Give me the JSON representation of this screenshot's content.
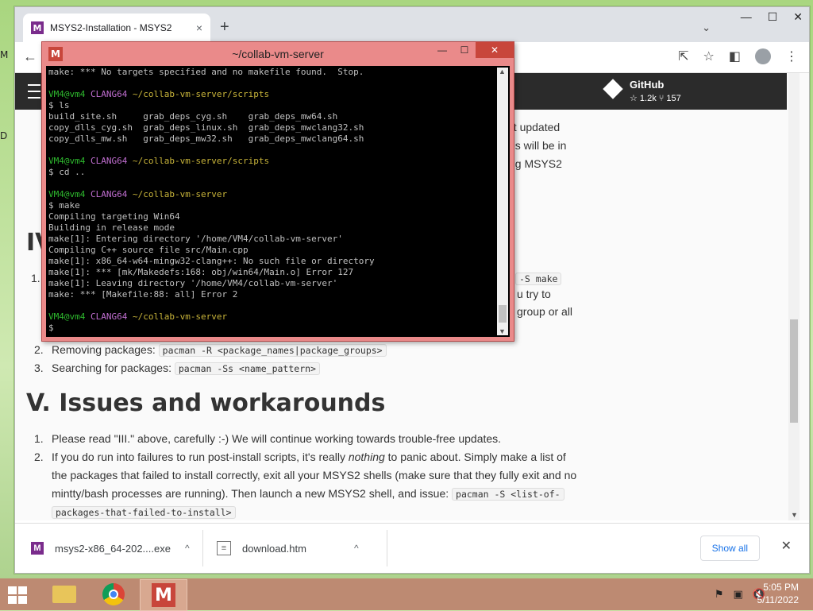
{
  "desktop": {
    "edge_left_1": "M",
    "edge_left_2": "D"
  },
  "browser": {
    "tab_title": "MSYS2-Installation - MSYS2",
    "tab_favicon": "M",
    "new_tab": "+",
    "tab_close": "×",
    "win_min": "—",
    "win_max": "☐",
    "win_close": "✕",
    "tab_dropdown": "⌄",
    "back": "←",
    "toolbar_icons": {
      "share": "⇱",
      "star": "☆",
      "sidebar": "◧",
      "menu": "⋮"
    }
  },
  "site": {
    "github_name": "GitHub",
    "github_stats": "☆ 1.2k  ⑂ 157",
    "frag_not_updated": "ot updated",
    "frag_will_be_in": "es will be in",
    "frag_msys2": "ng MSYS2",
    "heading_iv": "IV",
    "frag_s_make": "-S make",
    "frag_u_try": "u try to",
    "frag_group": "group or all",
    "item2_label": "Removing packages:",
    "item2_code": "pacman -R <package_names|package_groups>",
    "item3_label": "Searching for packages:",
    "item3_code": "pacman -Ss <name_pattern>",
    "heading_v": "V. Issues and workarounds",
    "v1": "Please read \"III.\" above, carefully :-) We will continue working towards trouble-free updates.",
    "v2_a": "If you do run into failures to run post-install scripts, it's really ",
    "v2_em": "nothing",
    "v2_b": " to panic about. Simply make a list of",
    "v2_line2": "the packages that failed to install correctly, exit all your MSYS2 shells (make sure that they fully exit and no",
    "v2_line3": "mintty/bash processes are running). Then launch a new MSYS2 shell, and issue: ",
    "v2_code1": "pacman -S <list-of-",
    "v2_code2": "packages-that-failed-to-install>"
  },
  "terminal": {
    "title": "~/collab-vm-server",
    "icon": "M",
    "btn_min": "—",
    "btn_max": "☐",
    "btn_close": "✕",
    "lines": [
      "make: *** No targets specified and no makefile found.  Stop.",
      "",
      "PROMPT|VM4@vm4|CLANG64|~/collab-vm-server/scripts",
      "$ ls",
      "build_site.sh     grab_deps_cyg.sh    grab_deps_mw64.sh",
      "copy_dlls_cyg.sh  grab_deps_linux.sh  grab_deps_mwclang32.sh",
      "copy_dlls_mw.sh   grab_deps_mw32.sh   grab_deps_mwclang64.sh",
      "",
      "PROMPT|VM4@vm4|CLANG64|~/collab-vm-server/scripts",
      "$ cd ..",
      "",
      "PROMPT|VM4@vm4|CLANG64|~/collab-vm-server",
      "$ make",
      "Compiling targeting Win64",
      "Building in release mode",
      "make[1]: Entering directory '/home/VM4/collab-vm-server'",
      "Compiling C++ source file src/Main.cpp",
      "make[1]: x86_64-w64-mingw32-clang++: No such file or directory",
      "make[1]: *** [mk/Makedefs:168: obj/win64/Main.o] Error 127",
      "make[1]: Leaving directory '/home/VM4/collab-vm-server'",
      "make: *** [Makefile:88: all] Error 2",
      "",
      "PROMPT|VM4@vm4|CLANG64|~/collab-vm-server",
      "$"
    ]
  },
  "downloads": {
    "item1": "msys2-x86_64-202....exe",
    "item2": "download.htm",
    "show_all": "Show all",
    "close": "✕",
    "chevron": "^"
  },
  "taskbar": {
    "time": "5:05 PM",
    "date": "5/11/2022",
    "msys_letter": "M"
  }
}
